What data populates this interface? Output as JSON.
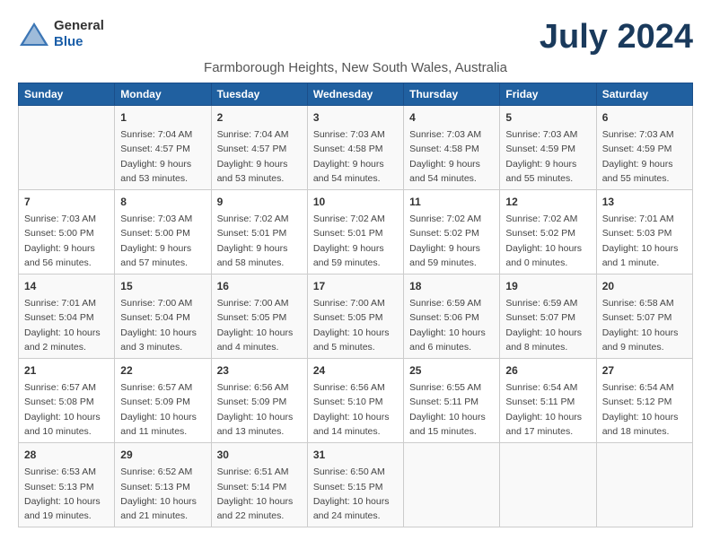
{
  "logo": {
    "general": "General",
    "blue": "Blue"
  },
  "month_title": "July 2024",
  "location": "Farmborough Heights, New South Wales, Australia",
  "days_of_week": [
    "Sunday",
    "Monday",
    "Tuesday",
    "Wednesday",
    "Thursday",
    "Friday",
    "Saturday"
  ],
  "weeks": [
    [
      {
        "day": "",
        "info": ""
      },
      {
        "day": "1",
        "info": "Sunrise: 7:04 AM\nSunset: 4:57 PM\nDaylight: 9 hours\nand 53 minutes."
      },
      {
        "day": "2",
        "info": "Sunrise: 7:04 AM\nSunset: 4:57 PM\nDaylight: 9 hours\nand 53 minutes."
      },
      {
        "day": "3",
        "info": "Sunrise: 7:03 AM\nSunset: 4:58 PM\nDaylight: 9 hours\nand 54 minutes."
      },
      {
        "day": "4",
        "info": "Sunrise: 7:03 AM\nSunset: 4:58 PM\nDaylight: 9 hours\nand 54 minutes."
      },
      {
        "day": "5",
        "info": "Sunrise: 7:03 AM\nSunset: 4:59 PM\nDaylight: 9 hours\nand 55 minutes."
      },
      {
        "day": "6",
        "info": "Sunrise: 7:03 AM\nSunset: 4:59 PM\nDaylight: 9 hours\nand 55 minutes."
      }
    ],
    [
      {
        "day": "7",
        "info": "Sunrise: 7:03 AM\nSunset: 5:00 PM\nDaylight: 9 hours\nand 56 minutes."
      },
      {
        "day": "8",
        "info": "Sunrise: 7:03 AM\nSunset: 5:00 PM\nDaylight: 9 hours\nand 57 minutes."
      },
      {
        "day": "9",
        "info": "Sunrise: 7:02 AM\nSunset: 5:01 PM\nDaylight: 9 hours\nand 58 minutes."
      },
      {
        "day": "10",
        "info": "Sunrise: 7:02 AM\nSunset: 5:01 PM\nDaylight: 9 hours\nand 59 minutes."
      },
      {
        "day": "11",
        "info": "Sunrise: 7:02 AM\nSunset: 5:02 PM\nDaylight: 9 hours\nand 59 minutes."
      },
      {
        "day": "12",
        "info": "Sunrise: 7:02 AM\nSunset: 5:02 PM\nDaylight: 10 hours\nand 0 minutes."
      },
      {
        "day": "13",
        "info": "Sunrise: 7:01 AM\nSunset: 5:03 PM\nDaylight: 10 hours\nand 1 minute."
      }
    ],
    [
      {
        "day": "14",
        "info": "Sunrise: 7:01 AM\nSunset: 5:04 PM\nDaylight: 10 hours\nand 2 minutes."
      },
      {
        "day": "15",
        "info": "Sunrise: 7:00 AM\nSunset: 5:04 PM\nDaylight: 10 hours\nand 3 minutes."
      },
      {
        "day": "16",
        "info": "Sunrise: 7:00 AM\nSunset: 5:05 PM\nDaylight: 10 hours\nand 4 minutes."
      },
      {
        "day": "17",
        "info": "Sunrise: 7:00 AM\nSunset: 5:05 PM\nDaylight: 10 hours\nand 5 minutes."
      },
      {
        "day": "18",
        "info": "Sunrise: 6:59 AM\nSunset: 5:06 PM\nDaylight: 10 hours\nand 6 minutes."
      },
      {
        "day": "19",
        "info": "Sunrise: 6:59 AM\nSunset: 5:07 PM\nDaylight: 10 hours\nand 8 minutes."
      },
      {
        "day": "20",
        "info": "Sunrise: 6:58 AM\nSunset: 5:07 PM\nDaylight: 10 hours\nand 9 minutes."
      }
    ],
    [
      {
        "day": "21",
        "info": "Sunrise: 6:57 AM\nSunset: 5:08 PM\nDaylight: 10 hours\nand 10 minutes."
      },
      {
        "day": "22",
        "info": "Sunrise: 6:57 AM\nSunset: 5:09 PM\nDaylight: 10 hours\nand 11 minutes."
      },
      {
        "day": "23",
        "info": "Sunrise: 6:56 AM\nSunset: 5:09 PM\nDaylight: 10 hours\nand 13 minutes."
      },
      {
        "day": "24",
        "info": "Sunrise: 6:56 AM\nSunset: 5:10 PM\nDaylight: 10 hours\nand 14 minutes."
      },
      {
        "day": "25",
        "info": "Sunrise: 6:55 AM\nSunset: 5:11 PM\nDaylight: 10 hours\nand 15 minutes."
      },
      {
        "day": "26",
        "info": "Sunrise: 6:54 AM\nSunset: 5:11 PM\nDaylight: 10 hours\nand 17 minutes."
      },
      {
        "day": "27",
        "info": "Sunrise: 6:54 AM\nSunset: 5:12 PM\nDaylight: 10 hours\nand 18 minutes."
      }
    ],
    [
      {
        "day": "28",
        "info": "Sunrise: 6:53 AM\nSunset: 5:13 PM\nDaylight: 10 hours\nand 19 minutes."
      },
      {
        "day": "29",
        "info": "Sunrise: 6:52 AM\nSunset: 5:13 PM\nDaylight: 10 hours\nand 21 minutes."
      },
      {
        "day": "30",
        "info": "Sunrise: 6:51 AM\nSunset: 5:14 PM\nDaylight: 10 hours\nand 22 minutes."
      },
      {
        "day": "31",
        "info": "Sunrise: 6:50 AM\nSunset: 5:15 PM\nDaylight: 10 hours\nand 24 minutes."
      },
      {
        "day": "",
        "info": ""
      },
      {
        "day": "",
        "info": ""
      },
      {
        "day": "",
        "info": ""
      }
    ]
  ]
}
